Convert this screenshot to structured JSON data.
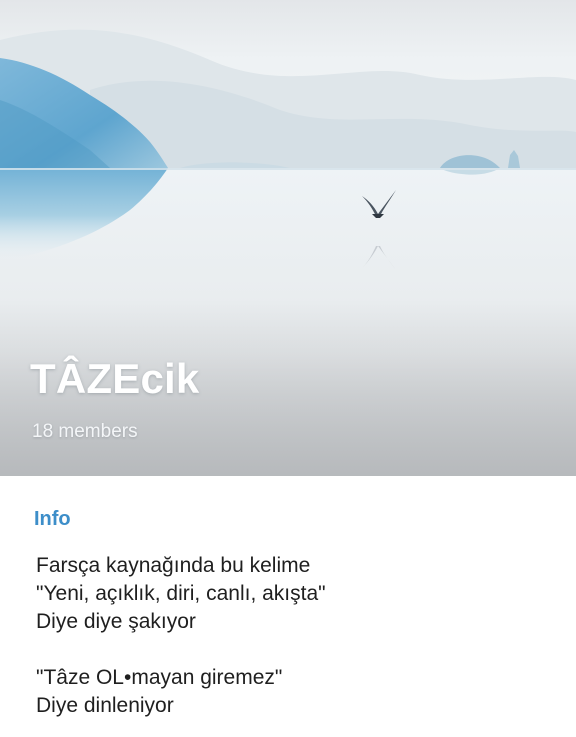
{
  "group": {
    "title": "TÂZEcik",
    "member_count": "18 members"
  },
  "info": {
    "heading": "Info",
    "lines": [
      "Farsça kaynağında bu kelime",
      "\"Yeni, açıklık, diri, canlı, akışta\"",
      "Diye diye şakıyor",
      "",
      "\"Tâze OL•mayan giremez\"",
      "Diye dinleniyor"
    ]
  },
  "colors": {
    "accent": "#3d8ec9",
    "text": "#1f1f1f",
    "header_sky": "#e6ecf0",
    "mountain": "#5aa6cf"
  },
  "header": {
    "image": "misty-lake-with-seagull"
  }
}
